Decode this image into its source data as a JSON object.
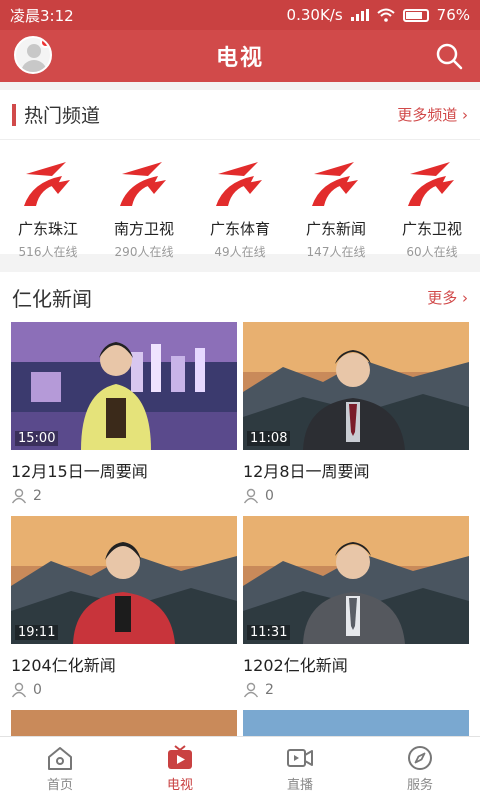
{
  "status": {
    "time": "凌晨3:12",
    "speed": "0.30K/s",
    "battery": "76%"
  },
  "appbar": {
    "title": "电视"
  },
  "hot": {
    "title": "热门频道",
    "more": "更多频道 ›",
    "channels": [
      {
        "name": "广东珠江",
        "online": "516人在线"
      },
      {
        "name": "南方卫视",
        "online": "290人在线"
      },
      {
        "name": "广东体育",
        "online": "49人在线"
      },
      {
        "name": "广东新闻",
        "online": "147人在线"
      },
      {
        "name": "广东卫视",
        "online": "60人在线"
      }
    ]
  },
  "news": {
    "title": "仁化新闻",
    "more": "更多 ›",
    "items": [
      {
        "title": "12月15日一周要闻",
        "duration": "15:00",
        "views": "2"
      },
      {
        "title": "12月8日一周要闻",
        "duration": "11:08",
        "views": "0"
      },
      {
        "title": "1204仁化新闻",
        "duration": "19:11",
        "views": "0"
      },
      {
        "title": "1202仁化新闻",
        "duration": "11:31",
        "views": "2"
      }
    ]
  },
  "tabs": [
    "首页",
    "电视",
    "直播",
    "服务"
  ],
  "colors": {
    "brand": "#d14a4a",
    "status_bar": "#c94141"
  }
}
